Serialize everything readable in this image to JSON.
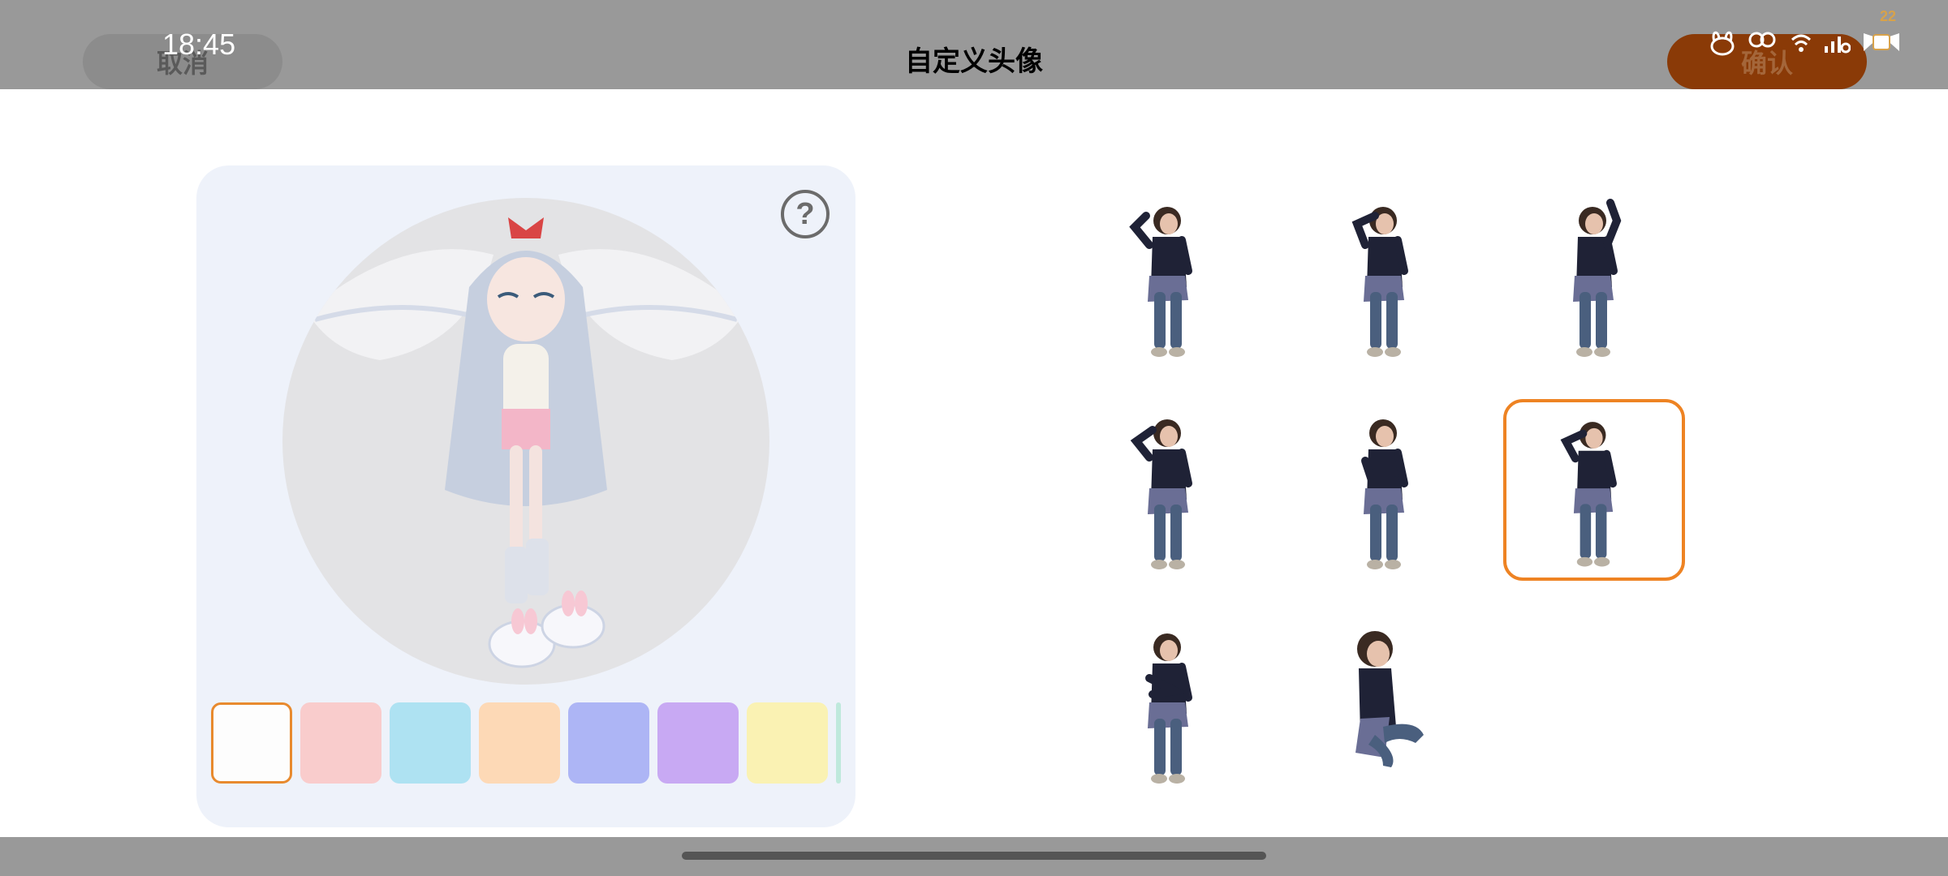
{
  "status_bar": {
    "time": "18:45",
    "battery_level": "22"
  },
  "header": {
    "cancel_label": "取消",
    "title": "自定义头像",
    "confirm_label": "确认"
  },
  "preview": {
    "help_label": "?",
    "background_colors": [
      {
        "name": "white",
        "color": "#fdfdfd",
        "selected": true
      },
      {
        "name": "pink",
        "color": "#f9cccc",
        "selected": false
      },
      {
        "name": "sky-blue",
        "color": "#aee2f2",
        "selected": false
      },
      {
        "name": "peach",
        "color": "#fdd9b6",
        "selected": false
      },
      {
        "name": "periwinkle",
        "color": "#adb5f5",
        "selected": false
      },
      {
        "name": "lavender",
        "color": "#c8a9f3",
        "selected": false
      },
      {
        "name": "light-yellow",
        "color": "#faf2b3",
        "selected": false
      },
      {
        "name": "mint",
        "color": "#bfe9dc",
        "selected": false
      }
    ]
  },
  "poses": {
    "count": 8,
    "selected_index": 5,
    "items": [
      {
        "pose": "salute-standing"
      },
      {
        "pose": "glasses-standing"
      },
      {
        "pose": "wave-standing"
      },
      {
        "pose": "salute-lean"
      },
      {
        "pose": "hands-front-standing"
      },
      {
        "pose": "salute-side"
      },
      {
        "pose": "arms-crossed"
      },
      {
        "pose": "sitting"
      }
    ]
  },
  "colors": {
    "accent": "#ee8323",
    "confirm_bg": "#8a3a07",
    "overlay": "#999999"
  }
}
